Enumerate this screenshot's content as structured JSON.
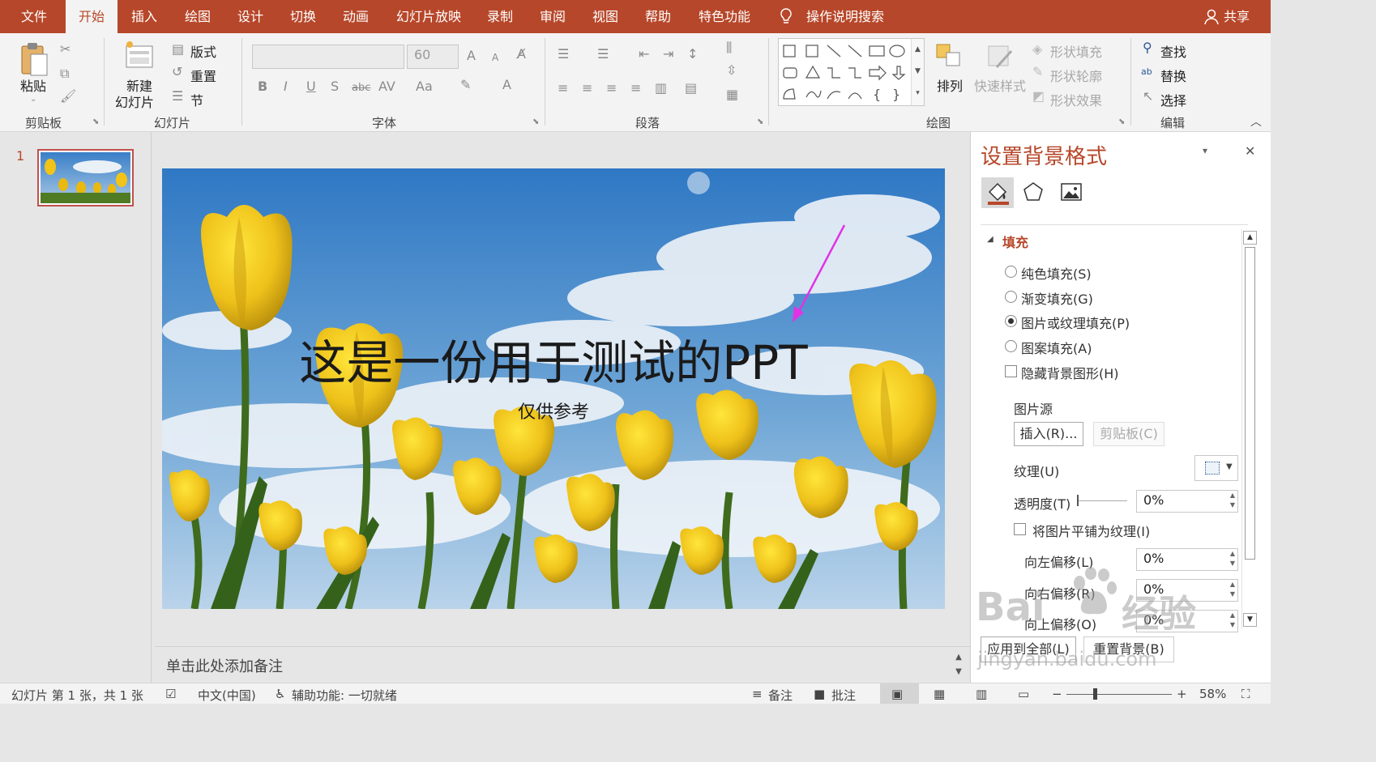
{
  "tabs": {
    "file": "文件",
    "home": "开始",
    "insert": "插入",
    "draw": "绘图",
    "design": "设计",
    "transitions": "切换",
    "animations": "动画",
    "slideshow": "幻灯片放映",
    "record": "录制",
    "review": "审阅",
    "view": "视图",
    "help": "帮助",
    "special": "特色功能",
    "tell_me": "操作说明搜索",
    "share": "共享"
  },
  "ribbon": {
    "paste": "粘贴",
    "layout": "版式",
    "reset": "重置",
    "new_slide_1": "新建",
    "new_slide_2": "幻灯片",
    "section": "节",
    "font_size": "60",
    "arrange": "排列",
    "quick_styles": "快速样式",
    "shape_fill": "形状填充",
    "shape_outline": "形状轮廓",
    "shape_effects": "形状效果",
    "find": "查找",
    "replace": "替换",
    "select": "选择",
    "groups": {
      "clipboard": "剪贴板",
      "slides": "幻灯片",
      "font": "字体",
      "paragraph": "段落",
      "drawing": "绘图",
      "editing": "编辑"
    }
  },
  "thumbnails": {
    "slide_number": "1"
  },
  "slide": {
    "title": "这是一份用于测试的PPT",
    "subtitle": "仅供参考"
  },
  "notes": {
    "placeholder": "单击此处添加备注"
  },
  "pane": {
    "title": "设置背景格式",
    "section": "填充",
    "options": {
      "solid": "纯色填充(S)",
      "gradient": "渐变填充(G)",
      "picture": "图片或纹理填充(P)",
      "pattern": "图案填充(A)",
      "hide_bg": "隐藏背景图形(H)"
    },
    "picture_source": "图片源",
    "insert_btn": "插入(R)...",
    "clipboard_btn": "剪贴板(C)",
    "texture": "纹理(U)",
    "transparency": "透明度(T)",
    "transparency_value": "0%",
    "tile": "将图片平铺为纹理(I)",
    "offset_left": "向左偏移(L)",
    "offset_left_value": "0%",
    "offset_right": "向右偏移(R)",
    "offset_right_value": "0%",
    "offset_top": "向上偏移(O)",
    "offset_top_value": "0%",
    "apply_all": "应用到全部(L)",
    "reset_bg": "重置背景(B)"
  },
  "status": {
    "slide_info": "幻灯片 第 1 张，共 1 张",
    "language": "中文(中国)",
    "accessibility": "辅助功能: 一切就绪",
    "notes": "备注",
    "comments": "批注",
    "zoom": "58%"
  },
  "watermark": {
    "text1": "Bai",
    "text2": "经验",
    "url": "jingyan.baidu.com"
  },
  "colors": {
    "accent": "#b7472a",
    "ribbon_bg": "#f3f3f3",
    "arrow": "#e033e6"
  }
}
